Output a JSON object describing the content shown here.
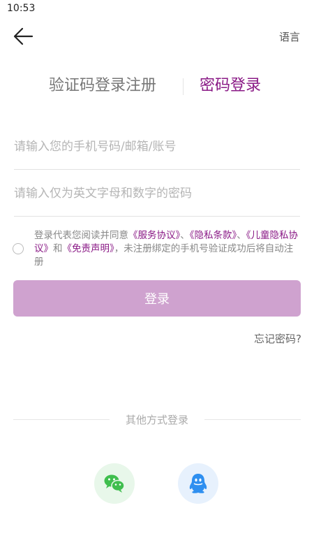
{
  "status_bar": {
    "time": "10:53"
  },
  "header": {
    "language_label": "语言"
  },
  "tabs": {
    "sms_login": "验证码登录注册",
    "password_login": "密码登录"
  },
  "form": {
    "account_placeholder": "请输入您的手机号码/邮箱/账号",
    "password_placeholder": "请输入仅为英文字母和数字的密码"
  },
  "agreement": {
    "prefix": "登录代表您阅读并同意",
    "service": "《服务协议》",
    "sep1": "、",
    "privacy": "《隐私条款》",
    "sep2": "、",
    "child_privacy": "《儿童隐私协议》",
    "and": "和",
    "disclaimer": "《免责声明》",
    "suffix": "，未注册绑定的手机号验证成功后将自动注册"
  },
  "login_button": "登录",
  "forgot_password": "忘记密码?",
  "other_login": {
    "title": "其他方式登录"
  },
  "colors": {
    "accent": "#8a1a86",
    "button": "#cfa2cf",
    "wechat": "#3fbe4e",
    "qq": "#2e8ff0"
  },
  "icons": {
    "back": "arrow-left-icon",
    "wechat": "wechat-icon",
    "qq": "qq-icon"
  }
}
